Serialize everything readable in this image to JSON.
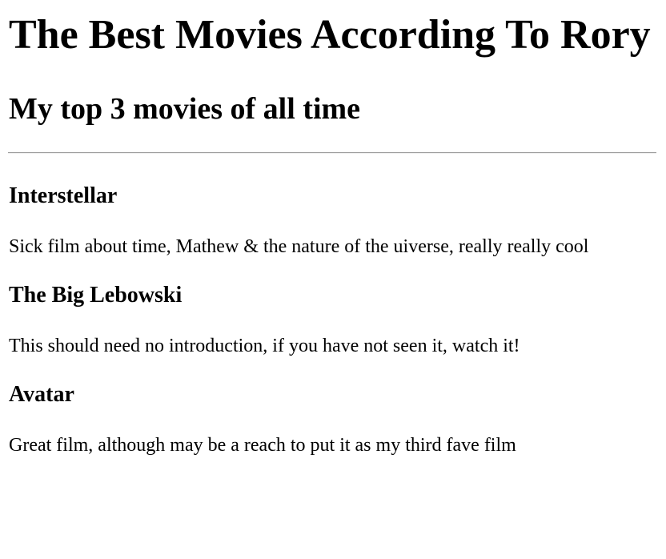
{
  "page": {
    "title": "The Best Movies According To Rory",
    "subtitle": "My top 3 movies of all time"
  },
  "movies": [
    {
      "title": "Interstellar",
      "description": "Sick film about time, Mathew & the nature of the uiverse, really really cool"
    },
    {
      "title": "The Big Lebowski",
      "description": "This should need no introduction, if you have not seen it, watch it!"
    },
    {
      "title": "Avatar",
      "description": "Great film, although may be a reach to put it as my third fave film"
    }
  ]
}
